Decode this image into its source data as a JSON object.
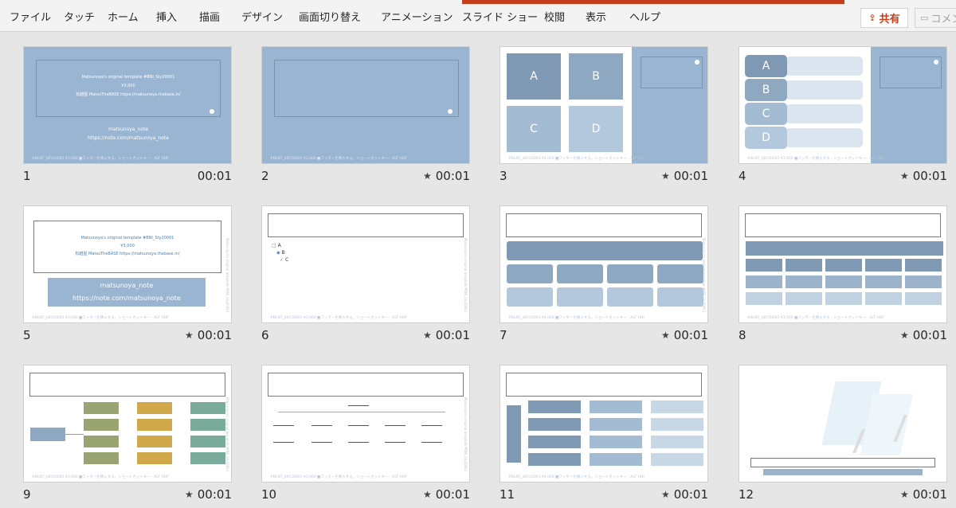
{
  "ribbon": {
    "tabs": [
      "ファイル",
      "タッチ",
      "ホーム",
      "挿入",
      "描画",
      "デザイン",
      "画面切り替え",
      "アニメーション",
      "スライド ショー",
      "校閲",
      "表示",
      "ヘルプ"
    ],
    "share_label": "共有",
    "comment_label": "コメント"
  },
  "slides": [
    {
      "number": "1",
      "duration": "00:01",
      "has_transition": false
    },
    {
      "number": "2",
      "duration": "00:01",
      "has_transition": true
    },
    {
      "number": "3",
      "duration": "00:01",
      "has_transition": true
    },
    {
      "number": "4",
      "duration": "00:01",
      "has_transition": true
    },
    {
      "number": "5",
      "duration": "00:01",
      "has_transition": true
    },
    {
      "number": "6",
      "duration": "00:01",
      "has_transition": true
    },
    {
      "number": "7",
      "duration": "00:01",
      "has_transition": true
    },
    {
      "number": "8",
      "duration": "00:01",
      "has_transition": true
    },
    {
      "number": "9",
      "duration": "00:01",
      "has_transition": true
    },
    {
      "number": "10",
      "duration": "00:01",
      "has_transition": true
    },
    {
      "number": "11",
      "duration": "00:01",
      "has_transition": true
    },
    {
      "number": "12",
      "duration": "00:01",
      "has_transition": true
    }
  ],
  "slide1": {
    "lines": [
      "Matsunoya's original template #BNI_Sty20001",
      "¥3,000",
      "松越屋 MatsuTheBASE https://matsunoya.thebase.in/"
    ],
    "note1": "matsunoya_note",
    "note2": "https://note.com/matsunoya_note"
  },
  "slide5": {
    "lines": [
      "Matsunoya's original template #BNI_Sty20001",
      "¥3,000",
      "松越屋 MatsuTheBASE https://matsunoya.thebase.in/"
    ],
    "note1": "matsunoya_note",
    "note2": "https://note.com/matsunoya_note"
  },
  "slide3": {
    "cells": [
      "A",
      "B",
      "C",
      "D"
    ]
  },
  "slide4": {
    "cells": [
      "A",
      "B",
      "C",
      "D"
    ]
  },
  "slide6": {
    "items": [
      "A",
      "B",
      "C"
    ]
  },
  "footer": "#BLNT_SKY20001 ¥3,000 ■フッターを挿入する。ショートカットキー：ALT HHF",
  "vertical_label": "Matsunoya's original template #BNI_Sty20001"
}
